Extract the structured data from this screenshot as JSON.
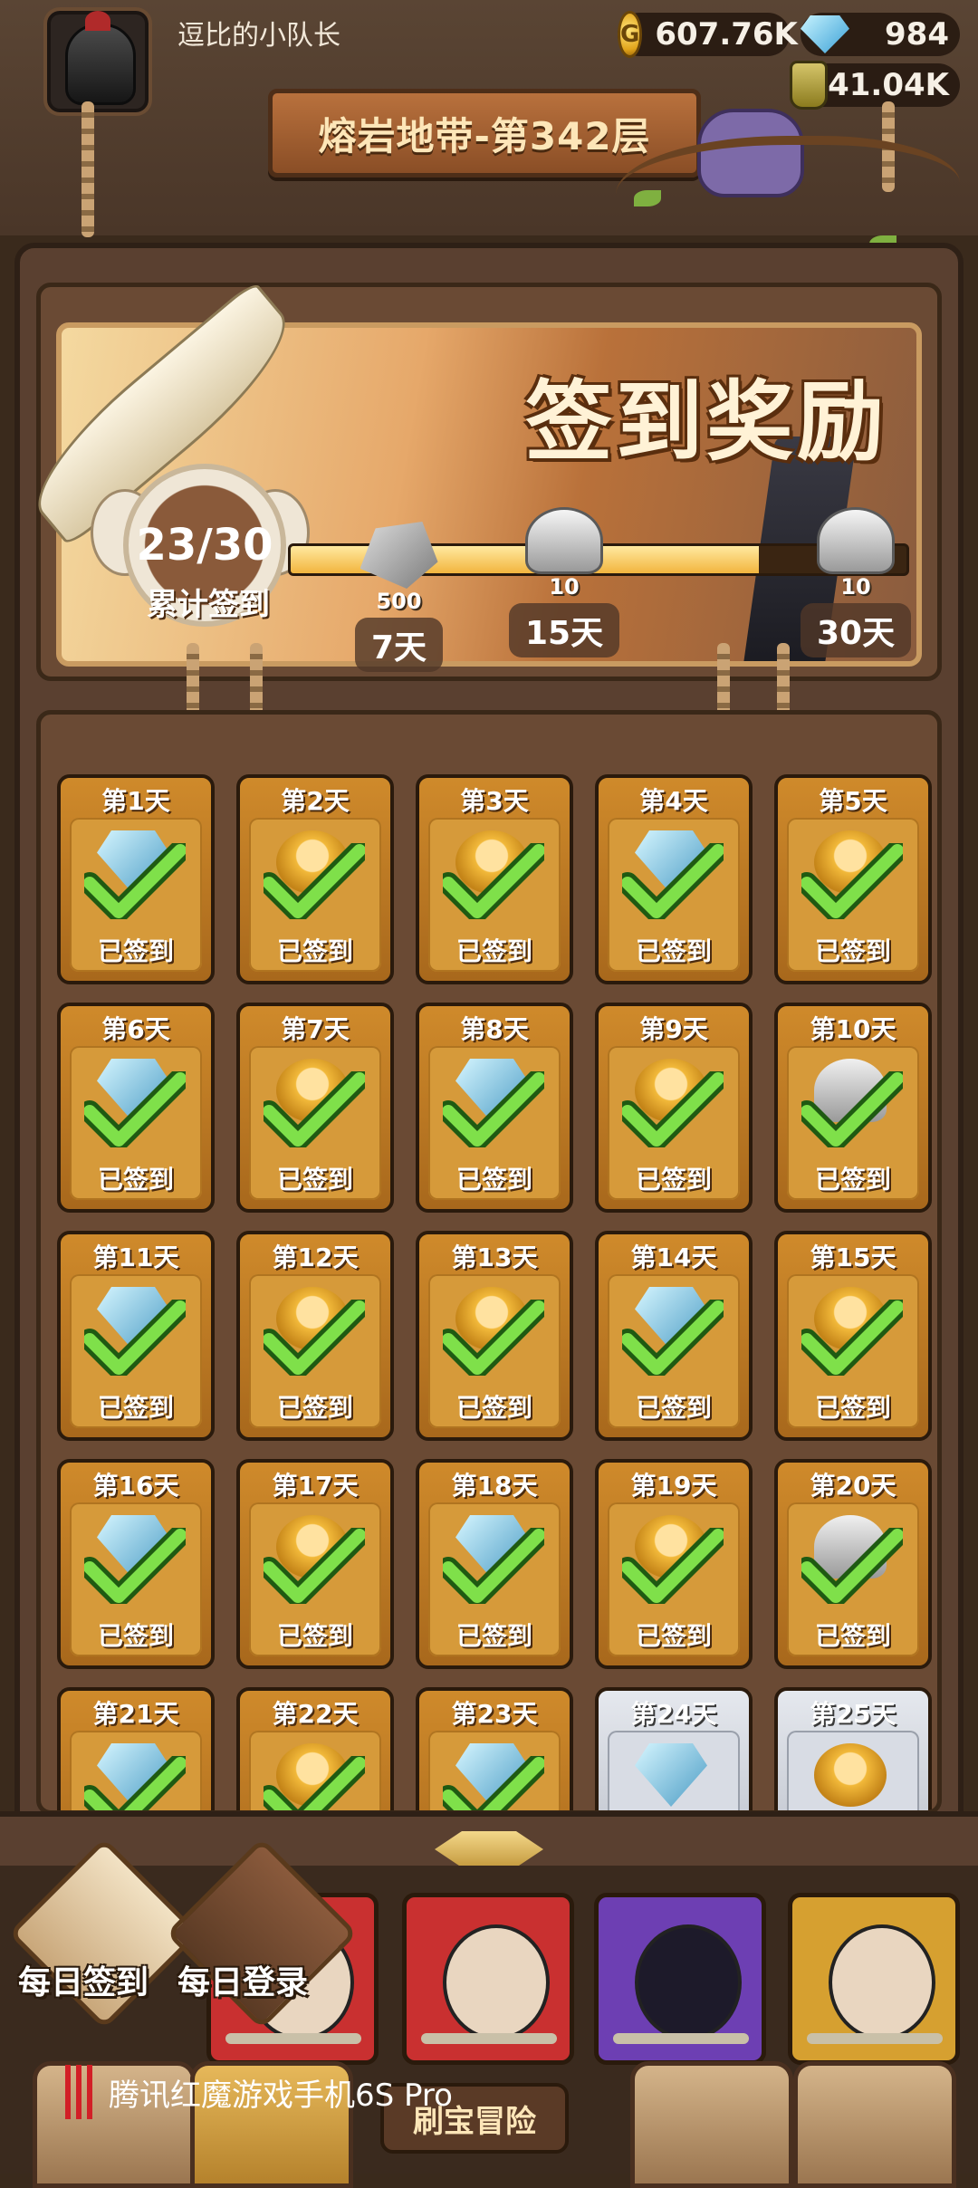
{
  "top_bar": {
    "player_name": "逗比的小队长",
    "gold": "607.76K",
    "gold_icon_glyph": "G",
    "gems": "984",
    "potion": "41.04K"
  },
  "floor_banner": "熔岩地带-第342层",
  "checkin": {
    "title": "签到奖励",
    "count_text": "23/30",
    "count_label": "累计签到",
    "progress_fraction": 0.76,
    "milestones": [
      {
        "value": "500",
        "day": "7天",
        "icon": "stone-icon"
      },
      {
        "value": "10",
        "day": "15天",
        "icon": "bell-icon"
      },
      {
        "value": "10",
        "day": "30天",
        "icon": "bell-icon"
      }
    ]
  },
  "status_checked": "已签到",
  "days": [
    {
      "label": "第1天",
      "reward": "gem",
      "checked": true
    },
    {
      "label": "第2天",
      "reward": "hero",
      "checked": true
    },
    {
      "label": "第3天",
      "reward": "hero",
      "checked": true
    },
    {
      "label": "第4天",
      "reward": "gem",
      "checked": true
    },
    {
      "label": "第5天",
      "reward": "hero",
      "checked": true
    },
    {
      "label": "第6天",
      "reward": "gem",
      "checked": true
    },
    {
      "label": "第7天",
      "reward": "hero",
      "checked": true
    },
    {
      "label": "第8天",
      "reward": "gem",
      "checked": true
    },
    {
      "label": "第9天",
      "reward": "hero",
      "checked": true
    },
    {
      "label": "第10天",
      "reward": "bell",
      "checked": true
    },
    {
      "label": "第11天",
      "reward": "gem",
      "checked": true
    },
    {
      "label": "第12天",
      "reward": "hero",
      "checked": true
    },
    {
      "label": "第13天",
      "reward": "hero",
      "checked": true
    },
    {
      "label": "第14天",
      "reward": "gem",
      "checked": true
    },
    {
      "label": "第15天",
      "reward": "hero",
      "checked": true
    },
    {
      "label": "第16天",
      "reward": "gem",
      "checked": true
    },
    {
      "label": "第17天",
      "reward": "hero",
      "checked": true
    },
    {
      "label": "第18天",
      "reward": "gem",
      "checked": true
    },
    {
      "label": "第19天",
      "reward": "hero",
      "checked": true
    },
    {
      "label": "第20天",
      "reward": "bell",
      "checked": true
    },
    {
      "label": "第21天",
      "reward": "gem",
      "checked": true
    },
    {
      "label": "第22天",
      "reward": "hero",
      "checked": true
    },
    {
      "label": "第23天",
      "reward": "gem",
      "checked": true
    },
    {
      "label": "第24天",
      "reward": "gem",
      "checked": false
    },
    {
      "label": "第25天",
      "reward": "hero",
      "checked": false
    }
  ],
  "bottom": {
    "daily_checkin": "每日签到",
    "daily_login": "每日登录",
    "adventure": "刷宝冒险"
  },
  "watermark": "腾讯红魔游戏手机6S Pro"
}
